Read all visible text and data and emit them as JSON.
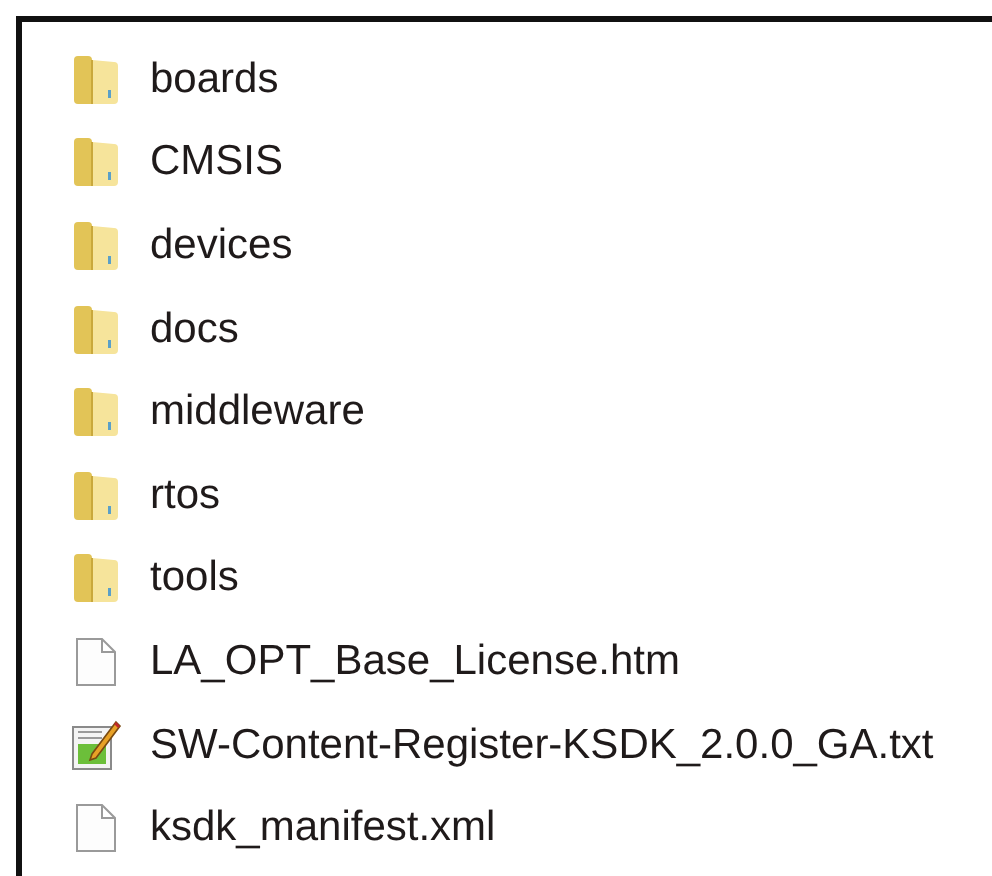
{
  "files": [
    {
      "name": "boards",
      "kind": "folder"
    },
    {
      "name": "CMSIS",
      "kind": "folder"
    },
    {
      "name": "devices",
      "kind": "folder"
    },
    {
      "name": "docs",
      "kind": "folder"
    },
    {
      "name": "middleware",
      "kind": "folder"
    },
    {
      "name": "rtos",
      "kind": "folder"
    },
    {
      "name": "tools",
      "kind": "folder"
    },
    {
      "name": "LA_OPT_Base_License.htm",
      "kind": "document"
    },
    {
      "name": "SW-Content-Register-KSDK_2.0.0_GA.txt",
      "kind": "text"
    },
    {
      "name": "ksdk_manifest.xml",
      "kind": "document"
    }
  ]
}
